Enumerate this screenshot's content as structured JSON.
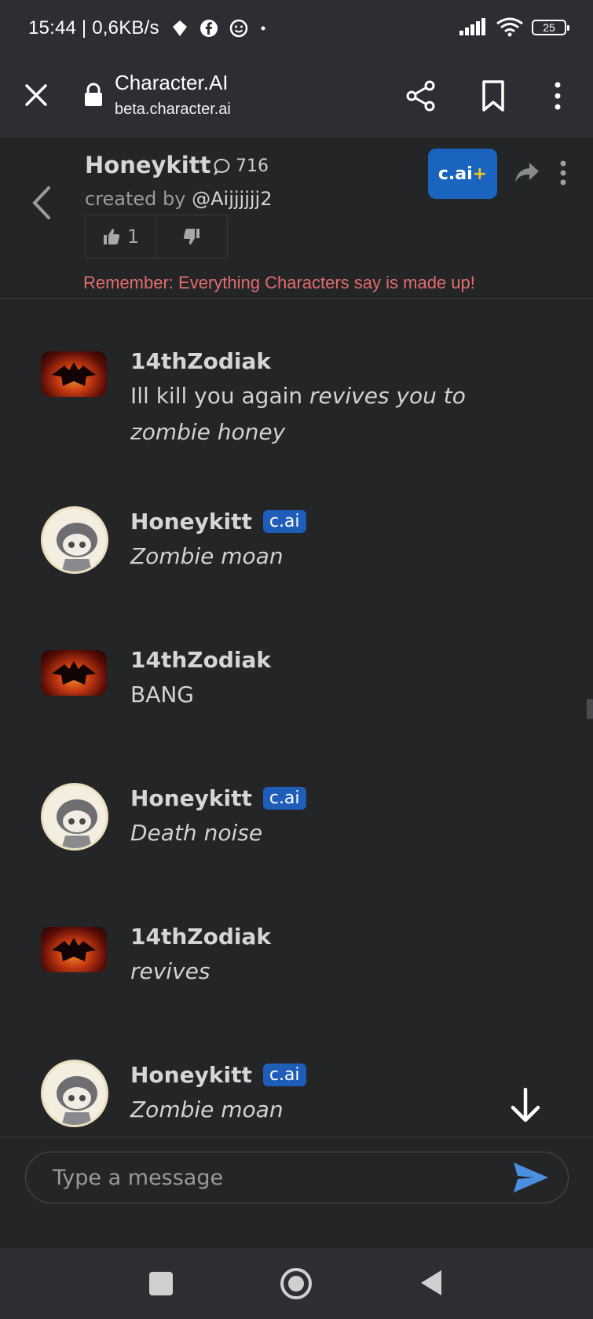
{
  "status_bar": {
    "time": "15:44 | 0,6KB/s",
    "battery": "25"
  },
  "browser": {
    "title": "Character.AI",
    "url": "beta.character.ai"
  },
  "character": {
    "name": "Honeykitt",
    "chat_count": "716",
    "creator_prefix": "created by ",
    "creator_handle": "@Aijjjjjj2",
    "likes": "1",
    "cai_plus_label": "c.ai",
    "cai_plus_suffix": "+",
    "disclaimer": "Remember: Everything Characters say is made up!"
  },
  "messages": [
    {
      "author": "14thZodiak",
      "is_bot": false,
      "text_plain": "Ill kill you again ",
      "text_italic": "revives you to zombie honey"
    },
    {
      "author": "Honeykitt",
      "is_bot": true,
      "badge": "c.ai",
      "text_plain": "",
      "text_italic": "Zombie moan"
    },
    {
      "author": "14thZodiak",
      "is_bot": false,
      "text_plain": "BANG",
      "text_italic": ""
    },
    {
      "author": "Honeykitt",
      "is_bot": true,
      "badge": "c.ai",
      "text_plain": "",
      "text_italic": "Death noise"
    },
    {
      "author": "14thZodiak",
      "is_bot": false,
      "text_plain": "",
      "text_italic": "revives"
    },
    {
      "author": "Honeykitt",
      "is_bot": true,
      "badge": "c.ai",
      "text_plain": "",
      "text_italic": "Zombie moan"
    }
  ],
  "input": {
    "placeholder": "Type a message"
  },
  "colors": {
    "background": "#242526",
    "accent": "#1a64c0",
    "disclaimer": "#e36c6c",
    "send": "#4a8fe0"
  }
}
